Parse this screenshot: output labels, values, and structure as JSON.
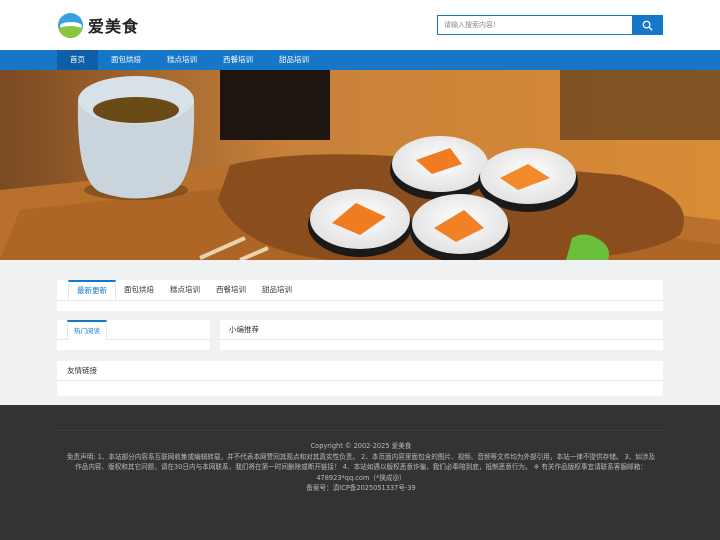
{
  "site": {
    "name": "爱美食"
  },
  "search": {
    "placeholder": "请输入搜索内容!"
  },
  "nav": {
    "items": [
      "首页",
      "面包烘焙",
      "糕点培训",
      "西餐培训",
      "甜品培训"
    ]
  },
  "tabs": {
    "items": [
      "最新更新",
      "面包烘焙",
      "糕点培训",
      "西餐培训",
      "甜品培训"
    ]
  },
  "panels": {
    "hot": "热门阅读",
    "recommend": "小编推荐",
    "links": "友情链接"
  },
  "footer": {
    "copyright": "Copyright © 2002-2025 爱美食",
    "disclaimer": "免责声明: 1、本站部分内容系互联网收集或编辑转载，并不代表本网赞同其观点和对其真实性负责。 2、本页面内容里面包含的图片、视频、音频等文件均为外部引用，本站一律不提供存储。 3、如涉及作品内容、版权和其它问题，请在30日内与本网联系，我们将在第一时间删除或断开链接！ 4、本站如遇以版权恶意诈骗，我们必奉陪到底，抵制恶意行为。 ※ 有关作品版权事宜请联系客服邮箱：478923*qq.com（*换成@）",
    "icp": "备案号：滇ICP备2025051337号-39"
  },
  "colors": {
    "primary": "#1677c8",
    "nav_active": "#0e5fa8",
    "footer_bg": "#333333"
  }
}
